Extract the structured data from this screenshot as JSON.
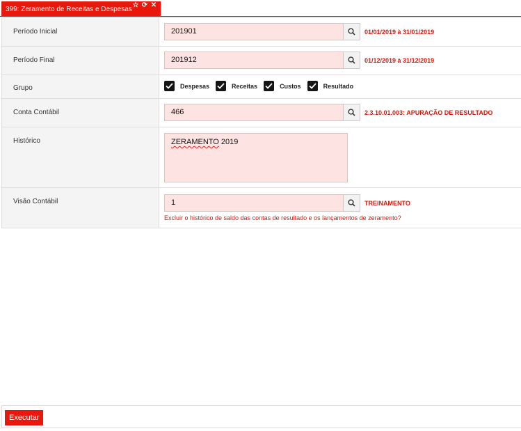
{
  "tab": {
    "title": "399: Zeramento de Receitas e Despesas"
  },
  "fields": {
    "periodo_inicial": {
      "label": "Período Inicial",
      "value": "201901",
      "description": "01/01/2019 à 31/01/2019"
    },
    "periodo_final": {
      "label": "Período Final",
      "value": "201912",
      "description": "01/12/2019 à 31/12/2019"
    },
    "grupo": {
      "label": "Grupo",
      "options": [
        {
          "label": "Despesas",
          "checked": true
        },
        {
          "label": "Receitas",
          "checked": true
        },
        {
          "label": "Custos",
          "checked": true
        },
        {
          "label": "Resultado",
          "checked": true
        }
      ]
    },
    "conta_contabil": {
      "label": "Conta Contábil",
      "value": "466",
      "description": "2.3.10.01.003: APURAÇÃO DE RESULTADO"
    },
    "historico": {
      "label": "Histórico",
      "value_word1": "ZERAMENTO",
      "value_word2": "2019"
    },
    "visao_contabil": {
      "label": "Visão Contábil",
      "value": "1",
      "description": "TREINAMENTO",
      "warning": "Excluir o histórico de saldo das contas de resultado e os lançamentos de zeramento?"
    }
  },
  "footer": {
    "execute_label": "Executar"
  },
  "colors": {
    "accent": "#e8190c",
    "input_bg": "#fde4e2",
    "label_bg": "#f4f4f4",
    "description": "#d11a0e"
  }
}
